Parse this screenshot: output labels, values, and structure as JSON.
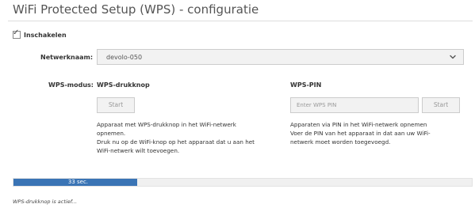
{
  "title": "WiFi Protected Setup (WPS) - configuratie",
  "enable": {
    "label": "Inschakelen",
    "checked": true
  },
  "network": {
    "label": "Netwerknaam:",
    "value": "devolo-050",
    "icon": "chevron-down-icon"
  },
  "wps_mode": {
    "label": "WPS-modus:",
    "button_section": {
      "title": "WPS-drukknop",
      "start_label": "Start",
      "description": [
        "Apparaat met WPS-drukknop in het WiFi-netwerk",
        "opnemen.",
        "Druk nu op de WiFi-knop op het apparaat dat u aan het",
        "WiFi-netwerk wilt toevoegen."
      ]
    },
    "pin_section": {
      "title": "WPS-PIN",
      "pin_placeholder": "Enter WPS PIN",
      "pin_value": "",
      "start_label": "Start",
      "description": [
        "Apparaten via PIN in het WiFi-netwerk opnemen",
        "Voer de PIN van het apparaat in dat aan uw WiFi-",
        "netwerk moet worden toegevoegd."
      ]
    }
  },
  "progress": {
    "label": "33 sec.",
    "fraction": 0.27
  },
  "status": "WPS-drukknop is actief...",
  "colors": {
    "progress_fill": "#3a74b5",
    "progress_track": "#f0f0f0"
  }
}
